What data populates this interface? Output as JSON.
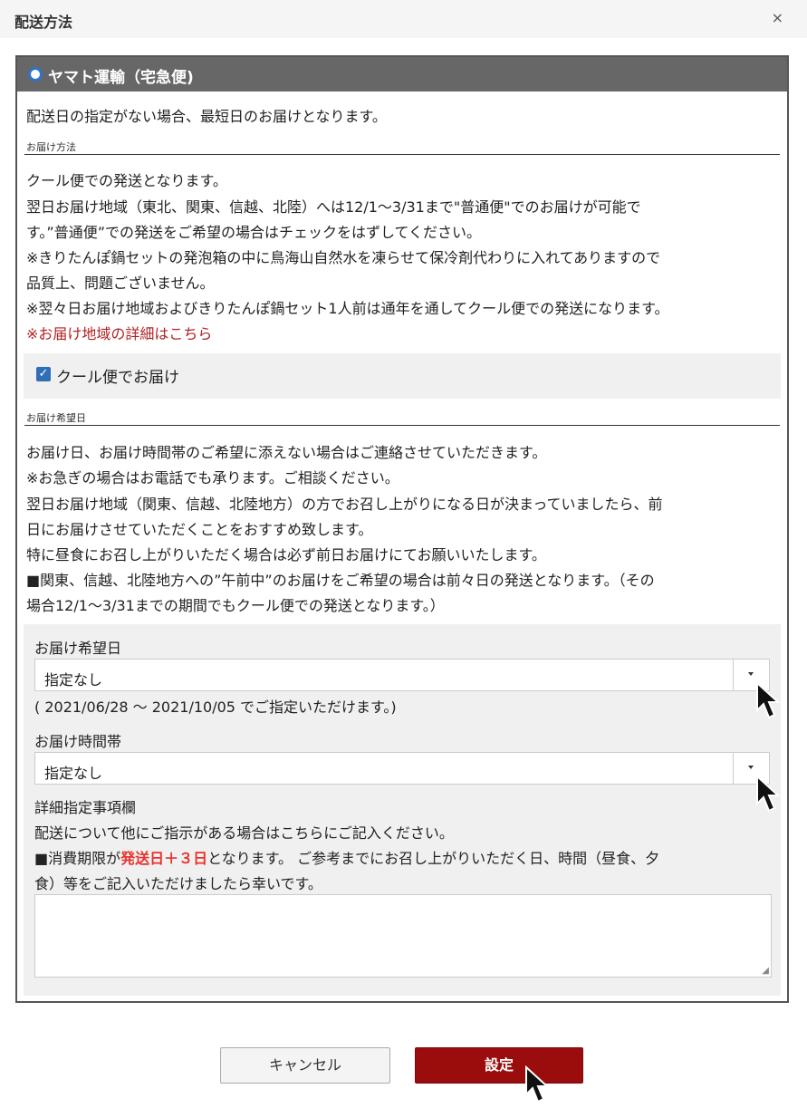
{
  "dialog": {
    "title": "配送方法",
    "close": "×"
  },
  "carrier": {
    "name": "ヤマト運輸（宅急便)",
    "note": "配送日の指定がない場合、最短日のお届けとなります。"
  },
  "delivery_method": {
    "heading": "お届け方法",
    "lines": [
      "クール便での発送となります。",
      "翌日お届け地域（東北、関東、信越、北陸）へは12/1～3/31まで\"普通便\"でのお届けが可能で",
      "す。”普通便”での発送をご希望の場合はチェックをはずしてください。",
      "※きりたんぽ鍋セットの発泡箱の中に鳥海山自然水を凍らせて保冷剤代わりに入れてありますので",
      "品質上、問題ございません。",
      "※翌々日お届け地域およびきりたんぽ鍋セット1人前は通年を通してクール便での発送になります。"
    ],
    "link": "※お届け地域の詳細はこちら",
    "checkbox_label": "クール便でお届け"
  },
  "delivery_date_info": {
    "heading": "お届け希望日",
    "lines": [
      "お届け日、お届け時間帯のご希望に添えない場合はご連絡させていただきます。",
      "※お急ぎの場合はお電話でも承ります。ご相談ください。",
      "翌日お届け地域（関東、信越、北陸地方）の方でお召し上がりになる日が決まっていましたら、前",
      "日にお届けさせていただくことをおすすめ致します。",
      "特に昼食にお召し上がりいただく場合は必ず前日お届けにてお願いいたします。",
      "■関東、信越、北陸地方への”午前中”のお届けをご希望の場合は前々日の発送となります。（その",
      "場合12/1～3/31までの期間でもクール便での発送となります。）"
    ]
  },
  "form": {
    "date_label": "お届け希望日",
    "date_value": "指定なし",
    "date_range": "( 2021/06/28 ～ 2021/10/05 でご指定いただけます。)",
    "time_label": "お届け時間帯",
    "time_value": "指定なし",
    "notes_label": "詳細指定事項欄",
    "notes_line1": "配送について他にご指示がある場合はこちらにご記入ください。",
    "notes_line2_pre": "■消費期限が",
    "notes_line2_bold": "発送日＋３日",
    "notes_line2_post": "となります。 ご参考までにお召し上がりいただく日、時間（昼食、夕",
    "notes_line3": "食）等をご記入いただけましたら幸いです。"
  },
  "buttons": {
    "cancel": "キャンセル",
    "save": "設定"
  }
}
